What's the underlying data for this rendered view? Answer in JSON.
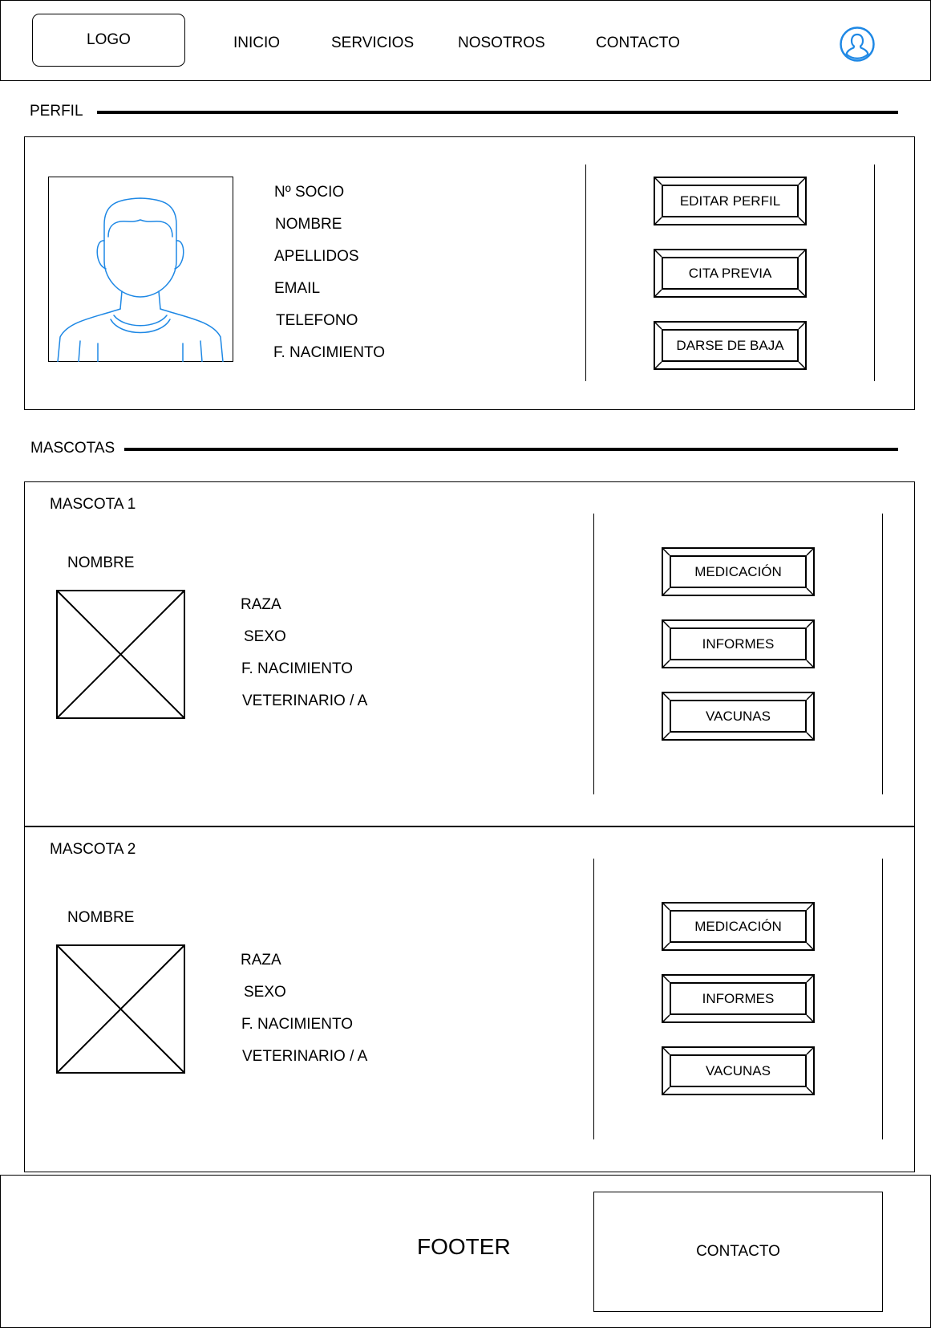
{
  "header": {
    "logo": "LOGO",
    "nav": [
      "INICIO",
      "SERVICIOS",
      "NOSOTROS",
      "CONTACTO"
    ],
    "user_icon": "user-icon",
    "accent_color": "#1E88E5"
  },
  "profile": {
    "section_title": "PERFIL",
    "avatar_icon": "avatar-placeholder",
    "fields": [
      "Nº SOCIO",
      "NOMBRE",
      "APELLIDOS",
      "EMAIL",
      "TELEFONO",
      "F. NACIMIENTO"
    ],
    "buttons": [
      "EDITAR PERFIL",
      "CITA PREVIA",
      "DARSE DE BAJA"
    ]
  },
  "pets": {
    "section_title": "MASCOTAS",
    "items": [
      {
        "title": "MASCOTA 1",
        "name_label": "NOMBRE",
        "fields": [
          "RAZA",
          "SEXO",
          "F. NACIMIENTO",
          "VETERINARIO / A"
        ],
        "buttons": [
          "MEDICACIÓN",
          "INFORMES",
          "VACUNAS"
        ]
      },
      {
        "title": "MASCOTA 2",
        "name_label": "NOMBRE",
        "fields": [
          "RAZA",
          "SEXO",
          "F. NACIMIENTO",
          "VETERINARIO / A"
        ],
        "buttons": [
          "MEDICACIÓN",
          "INFORMES",
          "VACUNAS"
        ]
      }
    ]
  },
  "footer": {
    "label": "FOOTER",
    "contact": "CONTACTO"
  }
}
